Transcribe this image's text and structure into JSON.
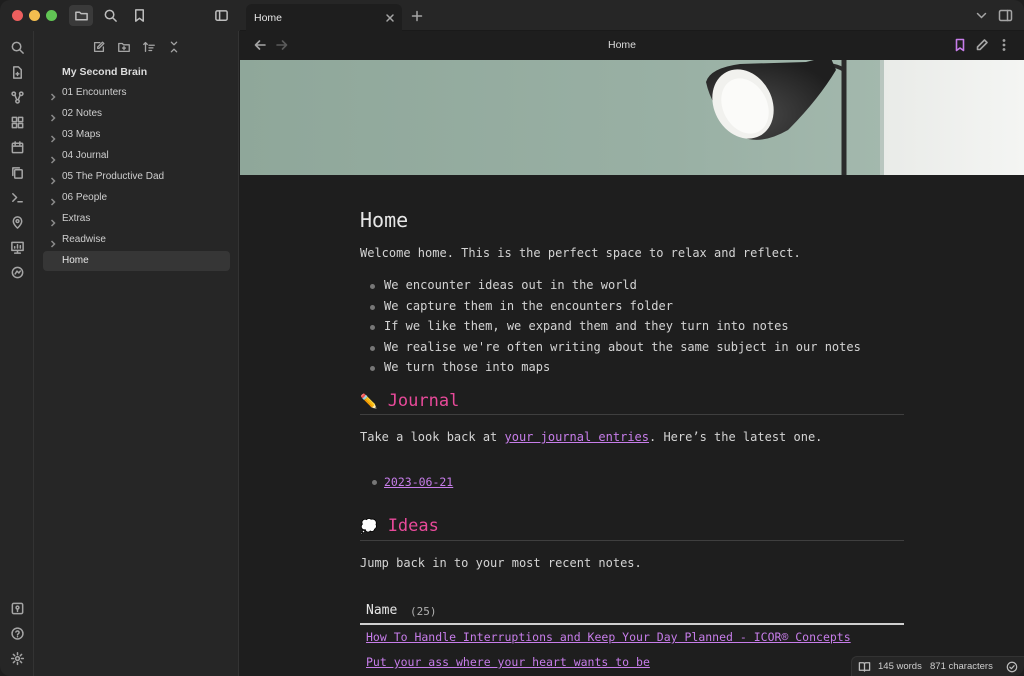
{
  "window": {
    "traffic_lights": [
      "#ec5f5e",
      "#f4be4f",
      "#61c554"
    ]
  },
  "toolbar_left": {
    "icons": [
      "folder-icon",
      "search-icon",
      "bookmark-icon",
      "sidebar-toggle-icon"
    ]
  },
  "ribbon": {
    "icons": [
      "search-icon",
      "file-plus-icon",
      "graph-icon",
      "canvas-icon",
      "calendar-icon",
      "copy-icon",
      "terminal-icon",
      "map-pin-icon",
      "presentation-icon",
      "sync-icon"
    ],
    "bottom_icons": [
      "vault-icon",
      "help-icon",
      "settings-icon"
    ]
  },
  "sidebar": {
    "vault_name": "My Second Brain",
    "actions": [
      "new-note-icon",
      "new-folder-icon",
      "sort-icon",
      "collapse-icon"
    ],
    "items": [
      {
        "label": "01 Encounters",
        "folder": true
      },
      {
        "label": "02 Notes",
        "folder": true
      },
      {
        "label": "03 Maps",
        "folder": true
      },
      {
        "label": "04 Journal",
        "folder": true
      },
      {
        "label": "05 The Productive Dad",
        "folder": true
      },
      {
        "label": "06 People",
        "folder": true
      },
      {
        "label": "Extras",
        "folder": true
      },
      {
        "label": "Readwise",
        "folder": true
      },
      {
        "label": "Home",
        "folder": false,
        "selected": true
      }
    ]
  },
  "tabs": [
    {
      "title": "Home",
      "active": true
    }
  ],
  "nav": {
    "title": "Home"
  },
  "note": {
    "title": "Home",
    "intro": "Welcome home. This is the perfect space to relax and reflect.",
    "bullets": [
      "We encounter ideas out in the world",
      "We capture them in the encounters folder",
      "If we like them, we expand them and they turn into notes",
      "We realise we're often writing about the same subject in our notes",
      "We turn those into maps"
    ],
    "journal": {
      "heading": "Journal",
      "emoji": "✏️",
      "text_before": "Take a look back at ",
      "link": "your journal entries",
      "text_after": ". Here’s the latest one.",
      "latest": "2023-06-21"
    },
    "ideas": {
      "heading": "Ideas",
      "emoji": "💭",
      "text": "Jump back in to your most recent notes.",
      "table_header": "Name",
      "table_count": "(25)",
      "rows": [
        "How To Handle Interruptions and Keep Your Day Planned - ICOR® Concepts",
        "Put your ass where your heart wants to be"
      ]
    }
  },
  "status": {
    "words": "145 words",
    "characters": "871 characters"
  },
  "colors": {
    "accent_pink": "#e84a9a",
    "link_purple": "#c77dea",
    "background": "#1e1e1e",
    "sidebar": "#262626",
    "banner_wall": "#95aca0"
  }
}
